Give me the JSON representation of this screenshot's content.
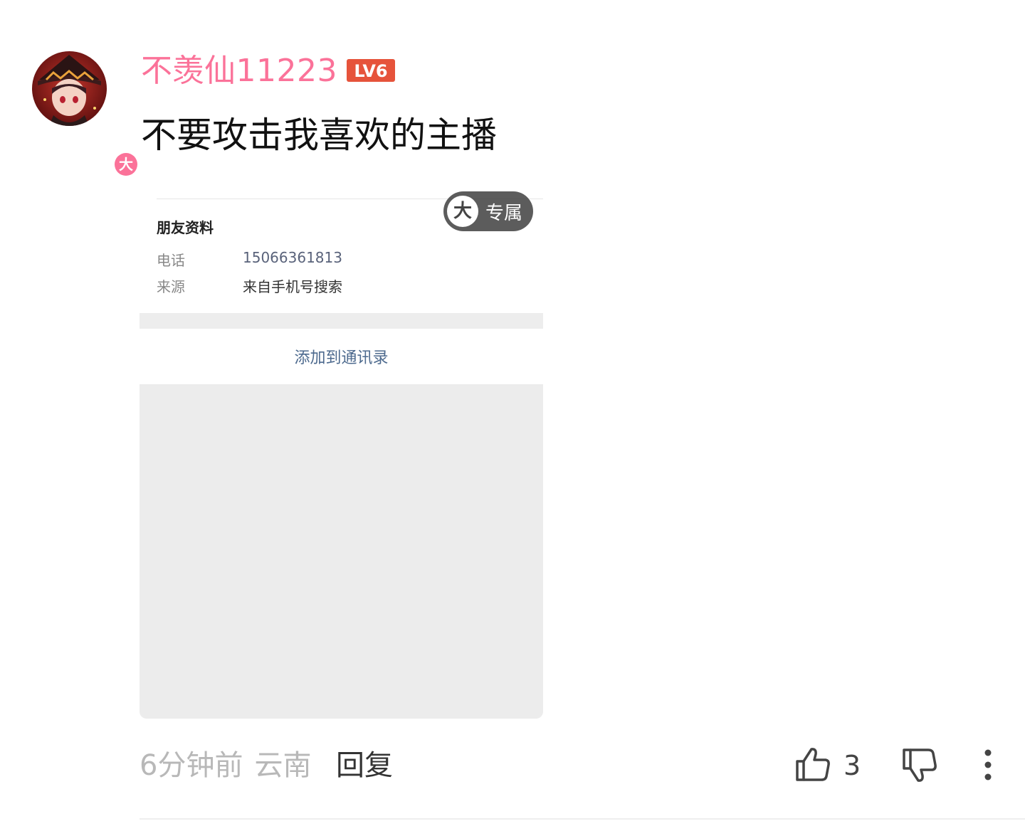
{
  "comment": {
    "username": "不羡仙11223",
    "level": "LV6",
    "text": "不要攻击我喜欢的主播",
    "vip_badge": "大",
    "time": "6分钟前",
    "location": "云南",
    "reply_label": "回复",
    "like_count": "3"
  },
  "attachment": {
    "exclusive_badge_char": "大",
    "exclusive_label": "专属",
    "card_title": "朋友资料",
    "rows": [
      {
        "label": "电话",
        "value": "15066361813"
      },
      {
        "label": "来源",
        "value": "来自手机号搜索"
      }
    ],
    "action_label": "添加到通讯录"
  },
  "colors": {
    "username": "#fb7299",
    "level_badge": "#e6533b",
    "meta_text": "#b8b8b8",
    "action_link": "#4d6a8e"
  },
  "icons": {
    "like": "thumbs-up-icon",
    "dislike": "thumbs-down-icon",
    "more": "more-vertical-icon"
  }
}
